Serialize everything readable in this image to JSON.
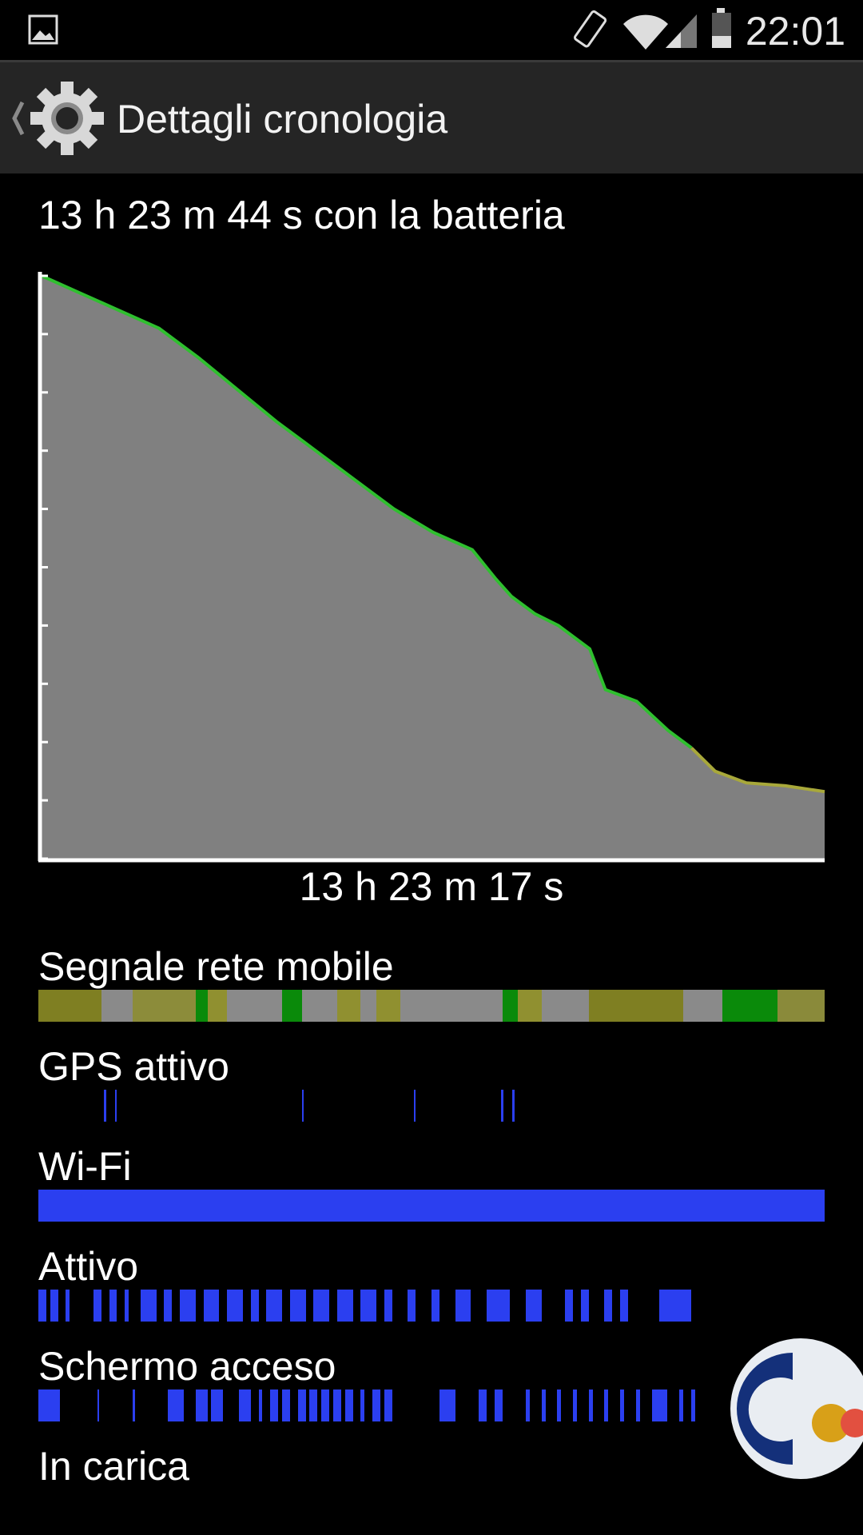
{
  "status_bar": {
    "time": "22:01",
    "icons": [
      "gallery-icon",
      "vibrate-icon",
      "wifi-icon",
      "cell-signal-icon",
      "battery-icon"
    ]
  },
  "action_bar": {
    "title": "Dettagli cronologia",
    "icon": "gear-icon",
    "back_icon": "chevron-left-icon"
  },
  "summary": "13 h 23 m 44 s con la batteria",
  "graph_duration": "13 h 23 m 17 s",
  "chart_data": {
    "type": "area",
    "series": [
      {
        "x": [
          0.0,
          0.05,
          0.15,
          0.2,
          0.3,
          0.35,
          0.45,
          0.5,
          0.55,
          0.58,
          0.6,
          0.63,
          0.66,
          0.7,
          0.72,
          0.76,
          0.8,
          0.83,
          0.86,
          0.9,
          0.95,
          1.0
        ],
        "y": [
          100,
          97,
          91,
          86,
          75,
          70,
          60,
          56,
          53,
          48,
          45,
          42,
          40,
          36,
          29,
          27,
          22,
          19,
          15,
          13,
          12.5,
          11.5
        ]
      }
    ],
    "colors": {
      "fill": "#808080",
      "line_good": "#2fbf2f",
      "line_low": "#a8a83a",
      "background": "#000000",
      "axis": "#ffffff"
    },
    "ylim": [
      0,
      100
    ],
    "grid": false
  },
  "rows": [
    {
      "label": "Segnale rete mobile",
      "type": "signal",
      "base_color": "#8c8c2a",
      "segments": [
        [
          0.0,
          0.08,
          "#7f7f22"
        ],
        [
          0.08,
          0.12,
          "#8a8a8a"
        ],
        [
          0.12,
          0.2,
          "#8c8c3a"
        ],
        [
          0.2,
          0.215,
          "#0a8a0a"
        ],
        [
          0.215,
          0.24,
          "#909030"
        ],
        [
          0.24,
          0.31,
          "#8a8a8a"
        ],
        [
          0.31,
          0.335,
          "#0a8a0a"
        ],
        [
          0.335,
          0.38,
          "#8a8a8a"
        ],
        [
          0.38,
          0.41,
          "#909030"
        ],
        [
          0.41,
          0.43,
          "#8a8a8a"
        ],
        [
          0.43,
          0.46,
          "#909030"
        ],
        [
          0.46,
          0.59,
          "#8a8a8a"
        ],
        [
          0.59,
          0.61,
          "#0a8a0a"
        ],
        [
          0.61,
          0.64,
          "#909030"
        ],
        [
          0.64,
          0.7,
          "#8a8a8a"
        ],
        [
          0.7,
          0.82,
          "#7f7f22"
        ],
        [
          0.82,
          0.87,
          "#8a8a8a"
        ],
        [
          0.87,
          0.94,
          "#0a8a0a"
        ],
        [
          0.94,
          1.0,
          "#8a8a3a"
        ]
      ]
    },
    {
      "label": "GPS attivo",
      "type": "bars",
      "color": "#2b3ff0",
      "segments": [
        [
          0.083,
          0.086
        ],
        [
          0.098,
          0.1
        ],
        [
          0.335,
          0.337
        ],
        [
          0.478,
          0.48
        ],
        [
          0.588,
          0.591
        ],
        [
          0.603,
          0.606
        ]
      ]
    },
    {
      "label": "Wi-Fi",
      "type": "bars",
      "color": "#2b3ff0",
      "segments": [
        [
          0.0,
          1.0
        ]
      ]
    },
    {
      "label": "Attivo",
      "type": "bars",
      "color": "#2b3ff0",
      "segments": [
        [
          0.0,
          0.01
        ],
        [
          0.015,
          0.025
        ],
        [
          0.035,
          0.04
        ],
        [
          0.07,
          0.08
        ],
        [
          0.09,
          0.1
        ],
        [
          0.11,
          0.115
        ],
        [
          0.13,
          0.15
        ],
        [
          0.16,
          0.17
        ],
        [
          0.18,
          0.2
        ],
        [
          0.21,
          0.23
        ],
        [
          0.24,
          0.26
        ],
        [
          0.27,
          0.28
        ],
        [
          0.29,
          0.31
        ],
        [
          0.32,
          0.34
        ],
        [
          0.35,
          0.37
        ],
        [
          0.38,
          0.4
        ],
        [
          0.41,
          0.43
        ],
        [
          0.44,
          0.45
        ],
        [
          0.47,
          0.48
        ],
        [
          0.5,
          0.51
        ],
        [
          0.53,
          0.55
        ],
        [
          0.57,
          0.6
        ],
        [
          0.62,
          0.64
        ],
        [
          0.67,
          0.68
        ],
        [
          0.69,
          0.7
        ],
        [
          0.72,
          0.73
        ],
        [
          0.74,
          0.75
        ],
        [
          0.79,
          0.83
        ],
        [
          0.83,
          0.83
        ],
        [
          0.83,
          0.83
        ],
        [
          0.83,
          0.83
        ],
        [
          0.83,
          0.83
        ],
        [
          0.83,
          0.83
        ],
        [
          0.83,
          0.83
        ],
        [
          0.83,
          0.83
        ],
        [
          0.83,
          0.83
        ],
        [
          0.83,
          0.83
        ],
        [
          0.83,
          0.83
        ],
        [
          0.83,
          0.83
        ],
        [
          0.83,
          0.83
        ],
        [
          0.83,
          0.83
        ],
        [
          0.83,
          0.83
        ],
        [
          0.83,
          0.83
        ],
        [
          0.83,
          0.83
        ]
      ]
    },
    {
      "label": "Schermo acceso",
      "type": "bars",
      "color": "#2b3ff0",
      "segments": [
        [
          0.0,
          0.027
        ],
        [
          0.075,
          0.077
        ],
        [
          0.12,
          0.123
        ],
        [
          0.165,
          0.185
        ],
        [
          0.2,
          0.215
        ],
        [
          0.22,
          0.235
        ],
        [
          0.255,
          0.27
        ],
        [
          0.28,
          0.285
        ],
        [
          0.295,
          0.305
        ],
        [
          0.31,
          0.32
        ],
        [
          0.33,
          0.34
        ],
        [
          0.345,
          0.355
        ],
        [
          0.36,
          0.37
        ],
        [
          0.375,
          0.385
        ],
        [
          0.39,
          0.4
        ],
        [
          0.41,
          0.415
        ],
        [
          0.425,
          0.435
        ],
        [
          0.44,
          0.45
        ],
        [
          0.51,
          0.53
        ],
        [
          0.56,
          0.57
        ],
        [
          0.58,
          0.59
        ],
        [
          0.62,
          0.625
        ],
        [
          0.64,
          0.645
        ],
        [
          0.66,
          0.665
        ],
        [
          0.68,
          0.685
        ],
        [
          0.7,
          0.705
        ],
        [
          0.72,
          0.725
        ],
        [
          0.74,
          0.745
        ],
        [
          0.76,
          0.765
        ],
        [
          0.78,
          0.8
        ],
        [
          0.815,
          0.82
        ],
        [
          0.83,
          0.835
        ]
      ]
    },
    {
      "label": "In carica",
      "type": "bars",
      "color": "#2b3ff0",
      "segments": []
    }
  ]
}
